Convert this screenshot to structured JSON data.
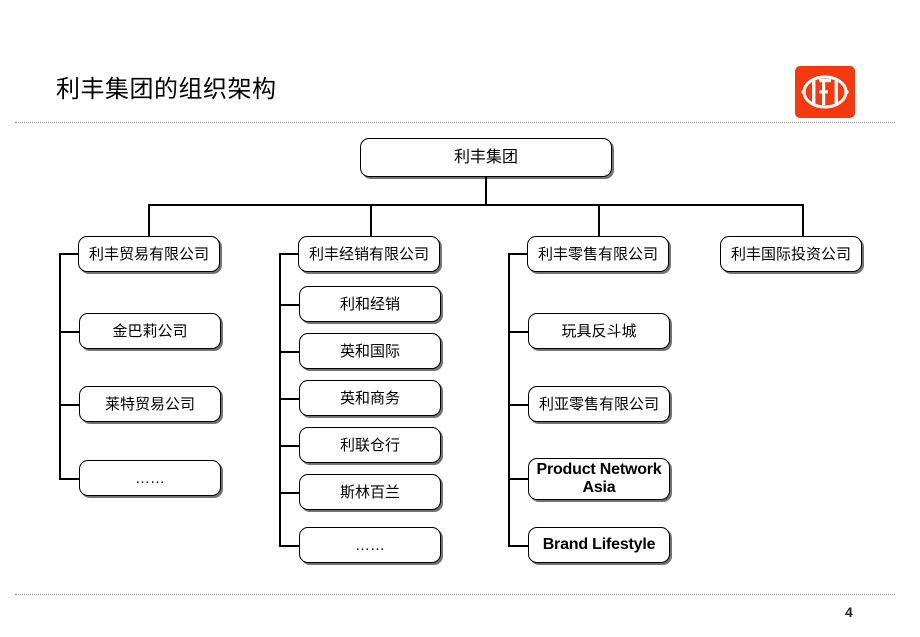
{
  "slide": {
    "title": "利丰集团的组织架构",
    "page_number": "4",
    "logo_name": "li-and-fung-logo",
    "logo_color": "#F4380F"
  },
  "chart_data": {
    "type": "diagram",
    "title": "利丰集团的组织架构",
    "root": {
      "label": "利丰集团"
    },
    "columns": [
      {
        "parent": "利丰贸易有限公司",
        "children": [
          "金巴莉公司",
          "莱特贸易公司",
          "……"
        ]
      },
      {
        "parent": "利丰经销有限公司",
        "children": [
          "利和经销",
          "英和国际",
          "英和商务",
          "利联仓行",
          "斯林百兰",
          "……"
        ]
      },
      {
        "parent": "利丰零售有限公司",
        "children": [
          "玩具反斗城",
          "利亚零售有限公司",
          "Product Network Asia",
          "Brand Lifestyle"
        ]
      },
      {
        "parent": "利丰国际投资公司",
        "children": []
      }
    ]
  },
  "nodes": {
    "root": "利丰集团",
    "c1_parent": "利丰贸易有限公司",
    "c1_ch1": "金巴莉公司",
    "c1_ch2": "莱特贸易公司",
    "c1_ch3": "……",
    "c2_parent": "利丰经销有限公司",
    "c2_ch1": "利和经销",
    "c2_ch2": "英和国际",
    "c2_ch3": "英和商务",
    "c2_ch4": "利联仓行",
    "c2_ch5": "斯林百兰",
    "c2_ch6": "……",
    "c3_parent": "利丰零售有限公司",
    "c3_ch1": "玩具反斗城",
    "c3_ch2": "利亚零售有限公司",
    "c3_ch3": "Product Network Asia",
    "c3_ch4": "Brand Lifestyle",
    "c4_parent": "利丰国际投资公司"
  }
}
